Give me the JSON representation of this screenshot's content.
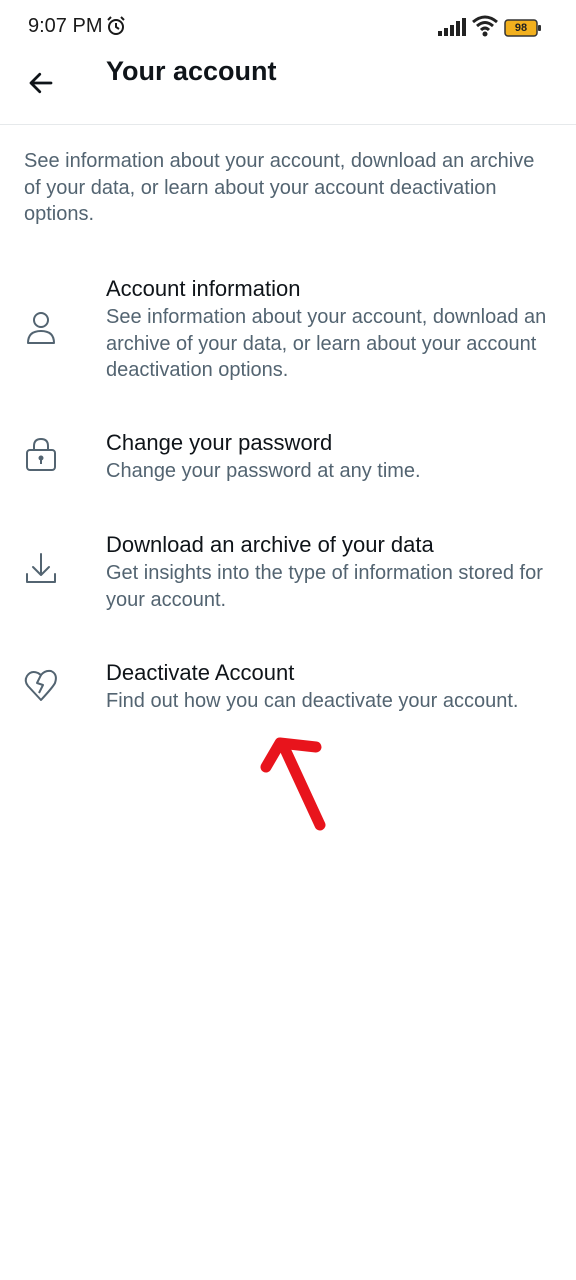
{
  "status_bar": {
    "time": "9:07 PM",
    "battery": "98",
    "icons": [
      "alarm-icon",
      "signal-icon",
      "wifi-icon",
      "battery-icon"
    ]
  },
  "header": {
    "title": "Your account",
    "back_icon": "arrow-left-icon"
  },
  "intro_text": "See information about your account, download an archive of your data, or learn about your account deactivation options.",
  "items": [
    {
      "title": "Account information",
      "description": "See information about your account, download an archive of your data, or learn about your account deactivation options.",
      "icon": "person-icon"
    },
    {
      "title": "Change your password",
      "description": "Change your password at any time.",
      "icon": "lock-icon"
    },
    {
      "title": "Download an archive of your data",
      "description": "Get insights into the type of information stored for your account.",
      "icon": "download-icon"
    },
    {
      "title": "Deactivate Account",
      "description": "Find out how you can deactivate your account.",
      "icon": "broken-heart-icon"
    }
  ],
  "colors": {
    "primary_text": "#0f1419",
    "secondary_text": "#536471",
    "divider": "#e6e9eb",
    "annotation": "#e8141c",
    "battery_fill": "#f2b01e"
  }
}
